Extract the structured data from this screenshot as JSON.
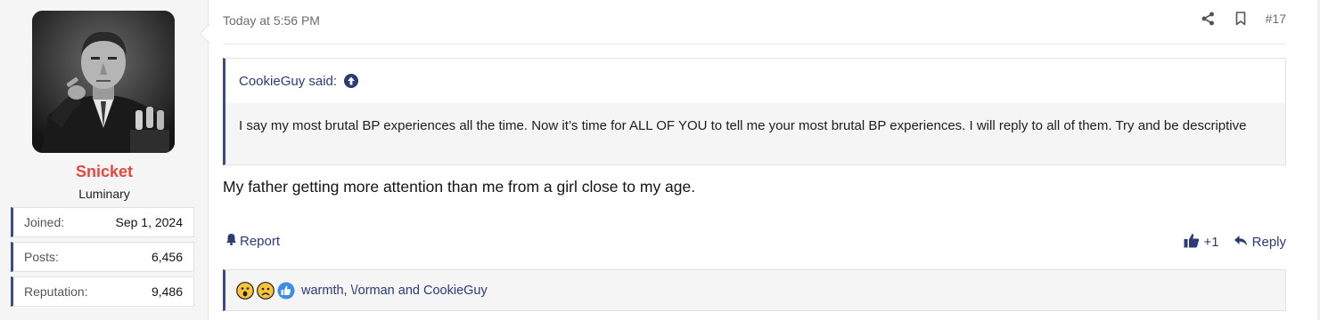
{
  "user": {
    "name": "Snicket",
    "title": "Luminary",
    "stats": [
      {
        "label": "Joined:",
        "value": "Sep 1, 2024"
      },
      {
        "label": "Posts:",
        "value": "6,456"
      },
      {
        "label": "Reputation:",
        "value": "9,486"
      }
    ],
    "name_color": "#e5473e"
  },
  "post": {
    "date": "Today at 5:56 PM",
    "number": "#17",
    "quote": {
      "author": "CookieGuy said:",
      "text": "I say my most brutal BP experiences all the time. Now it’s time for ALL OF YOU to tell me your most brutal BP experiences. I will reply to all of them. Try and be descriptive"
    },
    "message": "My father getting more attention than me from a girl close to my age.",
    "actions": {
      "report": "Report",
      "like_count": "+1",
      "reply": "Reply"
    },
    "reactions": {
      "icons": [
        "wow-emoji-icon",
        "sad-emoji-icon",
        "like-emoji-icon"
      ],
      "users": "warmth, \\/orman and CookieGuy"
    }
  },
  "colors": {
    "accent": "#3a4a8a",
    "link": "#2c3a78",
    "panel_bg": "#f5f5f5"
  }
}
